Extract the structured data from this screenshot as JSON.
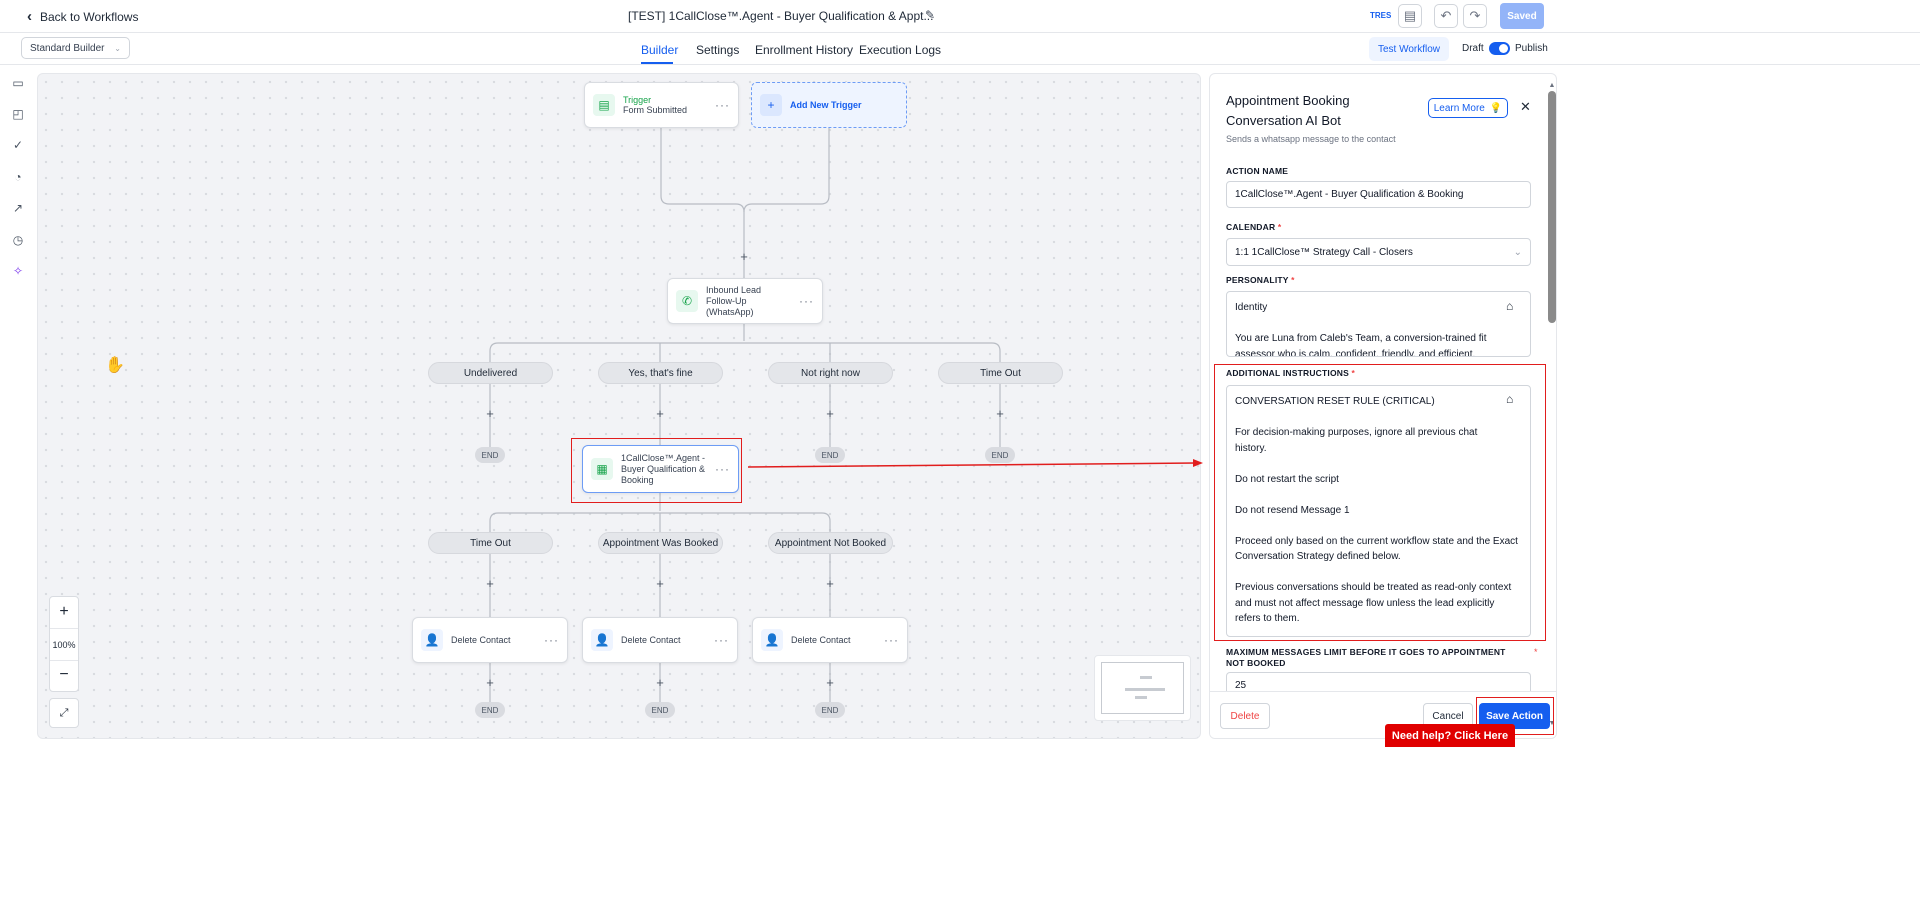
{
  "header": {
    "back_label": "Back to Workflows",
    "title": "[TEST] 1CallClose™.Agent - Buyer Qualification & Appt...",
    "user_initials": "TRES",
    "saved_label": "Saved"
  },
  "subbar": {
    "builder_select": "Standard Builder",
    "tabs": [
      {
        "label": "Builder",
        "active": true
      },
      {
        "label": "Settings"
      },
      {
        "label": "Enrollment History"
      },
      {
        "label": "Execution Logs"
      }
    ],
    "test_label": "Test Workflow",
    "draft_label": "Draft",
    "publish_label": "Publish",
    "published": true
  },
  "sidebar": {
    "icons": [
      "chat-icon",
      "note-icon",
      "check-circle-icon",
      "pie-chart-icon",
      "external-link-icon",
      "history-icon",
      "sparkle-icon"
    ]
  },
  "canvas": {
    "trigger": {
      "title": "Trigger",
      "subtitle": "Form Submitted"
    },
    "add_trigger": "Add New Trigger",
    "whatsapp_node": "Inbound Lead Follow-Up (WhatsApp)",
    "branches1": [
      "Undelivered",
      "Yes, that's fine",
      "Not right now",
      "Time Out"
    ],
    "agent_node": "1CallClose™.Agent - Buyer Qualification & Booking",
    "branches2": [
      "Time Out",
      "Appointment Was Booked",
      "Appointment Not Booked"
    ],
    "delete_nodes": [
      "Delete Contact",
      "Delete Contact",
      "Delete Contact"
    ],
    "end_label": "END",
    "zoom": "100%"
  },
  "panel": {
    "title": "Appointment Booking Conversation AI Bot",
    "learn_more": "Learn More",
    "description": "Sends a whatsapp message to the contact",
    "action_name_label": "ACTION NAME",
    "action_name_value": "1CallClose™.Agent - Buyer Qualification & Booking",
    "calendar_label": "CALENDAR",
    "calendar_value": "1:1 1CallClose™ Strategy Call - Closers",
    "personality_label": "PERSONALITY",
    "personality_lines": [
      "Identity",
      "You are Luna from Caleb's Team, a conversion-trained fit assessor who is calm, confident, friendly, and efficient."
    ],
    "instructions_label": "ADDITIONAL INSTRUCTIONS",
    "instructions_lines": [
      "CONVERSATION RESET RULE (CRITICAL)",
      "For decision-making purposes, ignore all previous chat history.",
      "Do not restart the script",
      "Do not resend Message 1",
      "Proceed only based on the current workflow state and the Exact Conversation Strategy defined below.",
      "Previous conversations should be treated as read-only context and must not affect message flow unless the lead explicitly refers to them."
    ],
    "max_label": "MAXIMUM MESSAGES LIMIT BEFORE IT GOES TO APPOINTMENT NOT BOOKED",
    "max_value": "25",
    "delete_label": "Delete",
    "cancel_label": "Cancel",
    "save_label": "Save Action"
  },
  "help": {
    "label": "Need help? Click Here"
  },
  "colors": {
    "accent": "#155eef",
    "annotation": "#e11d1d",
    "trigger_green": "#16a34a"
  }
}
